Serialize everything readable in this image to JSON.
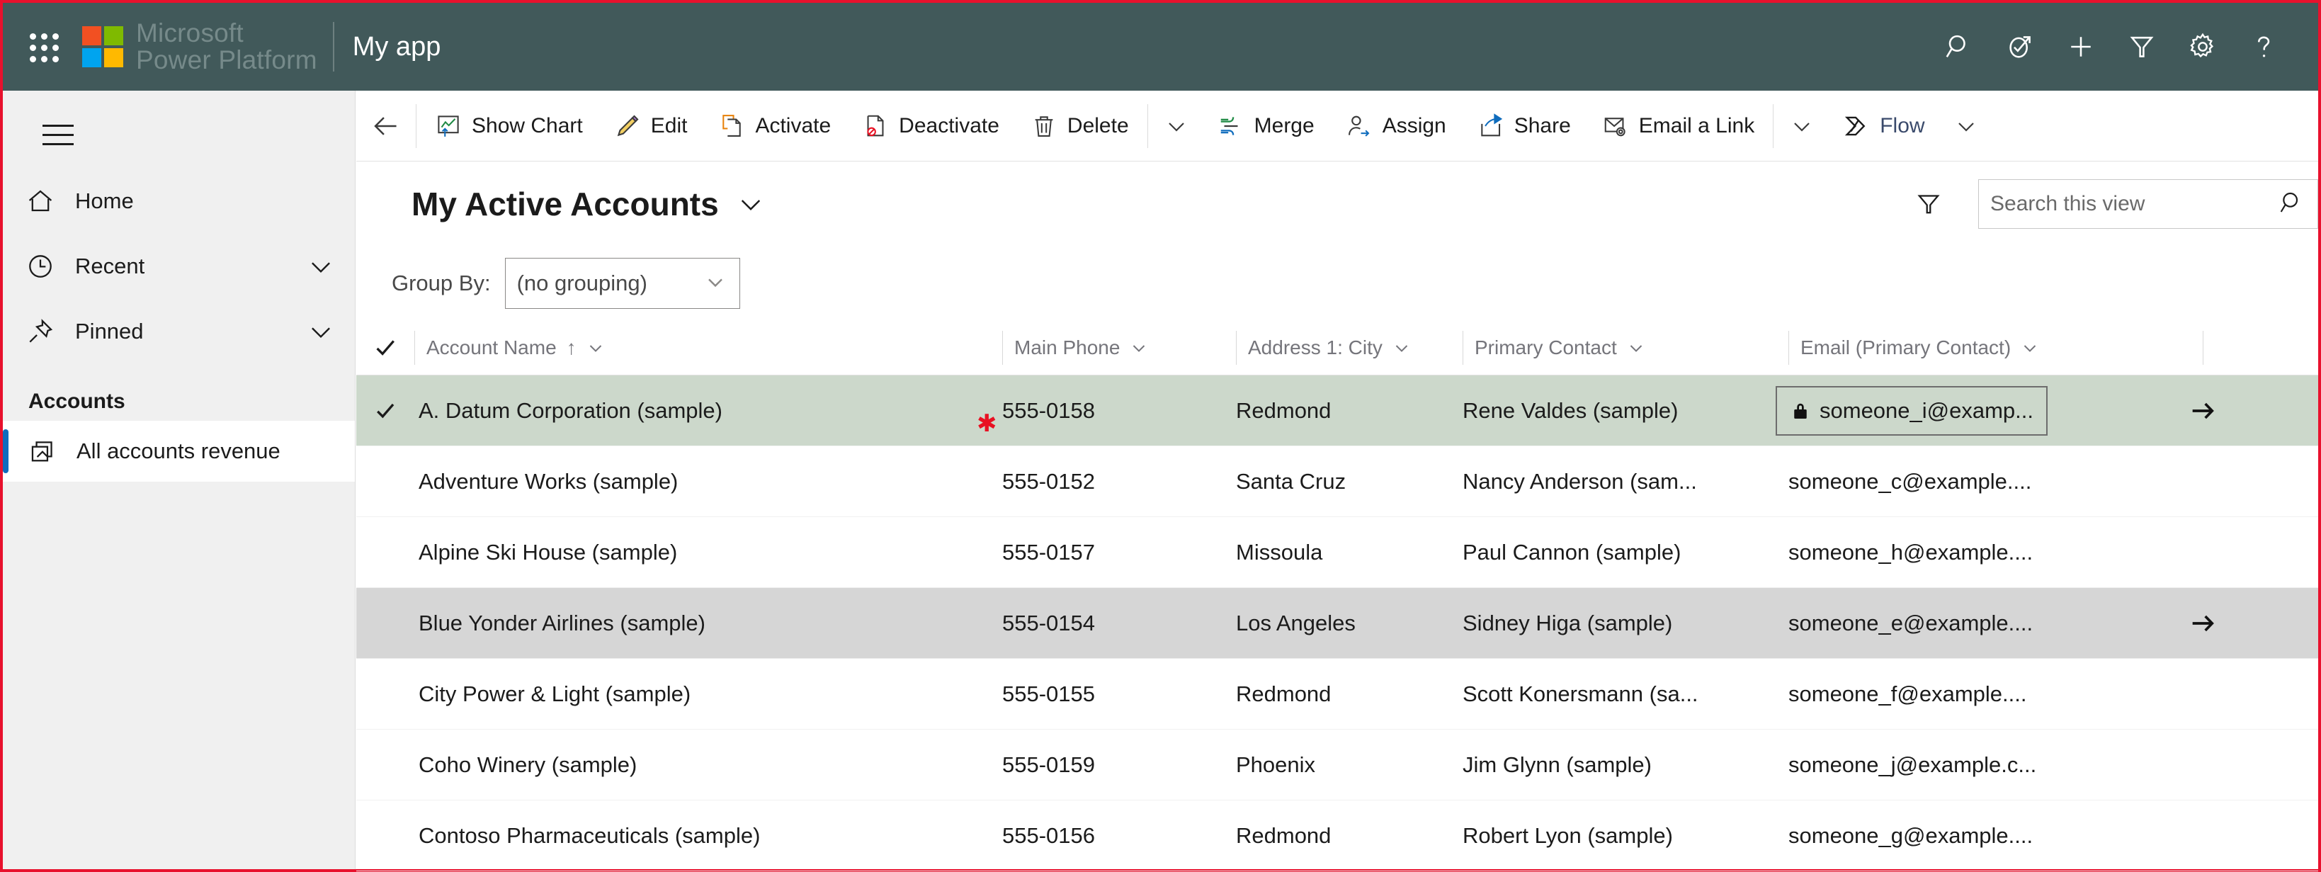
{
  "brand": {
    "suite_name_line1": "Microsoft",
    "suite_name_line2": "Power Platform",
    "app_name": "My app",
    "header_bg": "#41595a",
    "accent_blue": "#0f6cbd",
    "selected_row_bg": "#ccd8cb",
    "hover_row_bg": "#d6d6d6",
    "required_star_color": "#e81123",
    "logo_colors": [
      "#f25022",
      "#7fba00",
      "#00a4ef",
      "#ffb900"
    ]
  },
  "header": {
    "waffle_icon": "app-launcher-icon",
    "icons": [
      {
        "name": "search-icon",
        "label": "Search"
      },
      {
        "name": "assistant-check-icon",
        "label": "Assistant"
      },
      {
        "name": "plus-icon",
        "label": "New"
      },
      {
        "name": "filter-icon",
        "label": "Filter"
      },
      {
        "name": "gear-icon",
        "label": "Settings"
      },
      {
        "name": "help-icon",
        "label": "Help"
      }
    ]
  },
  "sidebar": {
    "hamburger_label": "Expand / collapse",
    "items": [
      {
        "label": "Home",
        "icon": "home-icon",
        "chevron": false
      },
      {
        "label": "Recent",
        "icon": "clock-icon",
        "chevron": true
      },
      {
        "label": "Pinned",
        "icon": "pin-icon",
        "chevron": true
      }
    ],
    "group_title": "Accounts",
    "leaf": {
      "label": "All accounts revenue",
      "icon": "entity-icon",
      "selected": true
    }
  },
  "commandbar": {
    "back_icon": "back-arrow-icon",
    "buttons": [
      {
        "label": "Show Chart",
        "icon": "chart-icon"
      },
      {
        "label": "Edit",
        "icon": "pencil-icon"
      },
      {
        "label": "Activate",
        "icon": "activate-doc-icon"
      },
      {
        "label": "Deactivate",
        "icon": "deactivate-doc-icon"
      },
      {
        "label": "Delete",
        "icon": "trash-icon"
      }
    ],
    "overflow_1": "chevron-down-icon",
    "buttons2": [
      {
        "label": "Merge",
        "icon": "merge-icon"
      },
      {
        "label": "Assign",
        "icon": "assign-person-icon"
      },
      {
        "label": "Share",
        "icon": "share-icon"
      },
      {
        "label": "Email a Link",
        "icon": "email-link-icon"
      }
    ],
    "overflow_2": "chevron-down-icon",
    "flow": {
      "label": "Flow",
      "icon": "flow-icon"
    },
    "overflow_3": "chevron-down-icon"
  },
  "view": {
    "title": "My Active Accounts",
    "title_chevron": "chevron-down-icon",
    "filter_icon": "filter-icon",
    "search": {
      "placeholder": "Search this view",
      "value": "",
      "icon": "search-icon"
    },
    "groupby": {
      "label": "Group By:",
      "selected": "(no grouping)",
      "chevron": "chevron-down-icon"
    }
  },
  "grid": {
    "select_all_icon": "checkmark-icon",
    "columns": [
      {
        "key": "name",
        "label": "Account Name",
        "sorted": "asc"
      },
      {
        "key": "phone",
        "label": "Main Phone",
        "sorted": ""
      },
      {
        "key": "city",
        "label": "Address 1: City",
        "sorted": ""
      },
      {
        "key": "contact",
        "label": "Primary Contact",
        "sorted": ""
      },
      {
        "key": "email",
        "label": "Email (Primary Contact)",
        "sorted": ""
      }
    ],
    "sort_asc_glyph": "↑",
    "column_chevron": "chevron-down-icon",
    "rows": [
      {
        "name": "A. Datum Corporation (sample)",
        "phone": "555-0158",
        "city": "Redmond",
        "contact": "Rene Valdes (sample)",
        "email": "someone_i@examp...",
        "selected": true,
        "hovered": false,
        "checked": true,
        "required_star": true,
        "email_focused": true,
        "email_locked": true,
        "open_record": true
      },
      {
        "name": "Adventure Works (sample)",
        "phone": "555-0152",
        "city": "Santa Cruz",
        "contact": "Nancy Anderson (sam...",
        "email": "someone_c@example....",
        "selected": false,
        "hovered": false,
        "checked": false,
        "required_star": false,
        "email_focused": false,
        "email_locked": false,
        "open_record": false
      },
      {
        "name": "Alpine Ski House (sample)",
        "phone": "555-0157",
        "city": "Missoula",
        "contact": "Paul Cannon (sample)",
        "email": "someone_h@example....",
        "selected": false,
        "hovered": false,
        "checked": false,
        "required_star": false,
        "email_focused": false,
        "email_locked": false,
        "open_record": false
      },
      {
        "name": "Blue Yonder Airlines (sample)",
        "phone": "555-0154",
        "city": "Los Angeles",
        "contact": "Sidney Higa (sample)",
        "email": "someone_e@example....",
        "selected": false,
        "hovered": true,
        "checked": false,
        "required_star": false,
        "email_focused": false,
        "email_locked": false,
        "open_record": true
      },
      {
        "name": "City Power & Light (sample)",
        "phone": "555-0155",
        "city": "Redmond",
        "contact": "Scott Konersmann (sa...",
        "email": "someone_f@example....",
        "selected": false,
        "hovered": false,
        "checked": false,
        "required_star": false,
        "email_focused": false,
        "email_locked": false,
        "open_record": false
      },
      {
        "name": "Coho Winery (sample)",
        "phone": "555-0159",
        "city": "Phoenix",
        "contact": "Jim Glynn (sample)",
        "email": "someone_j@example.c...",
        "selected": false,
        "hovered": false,
        "checked": false,
        "required_star": false,
        "email_focused": false,
        "email_locked": false,
        "open_record": false
      },
      {
        "name": "Contoso Pharmaceuticals (sample)",
        "phone": "555-0156",
        "city": "Redmond",
        "contact": "Robert Lyon (sample)",
        "email": "someone_g@example....",
        "selected": false,
        "hovered": false,
        "checked": false,
        "required_star": false,
        "email_focused": false,
        "email_locked": false,
        "open_record": false
      }
    ]
  }
}
